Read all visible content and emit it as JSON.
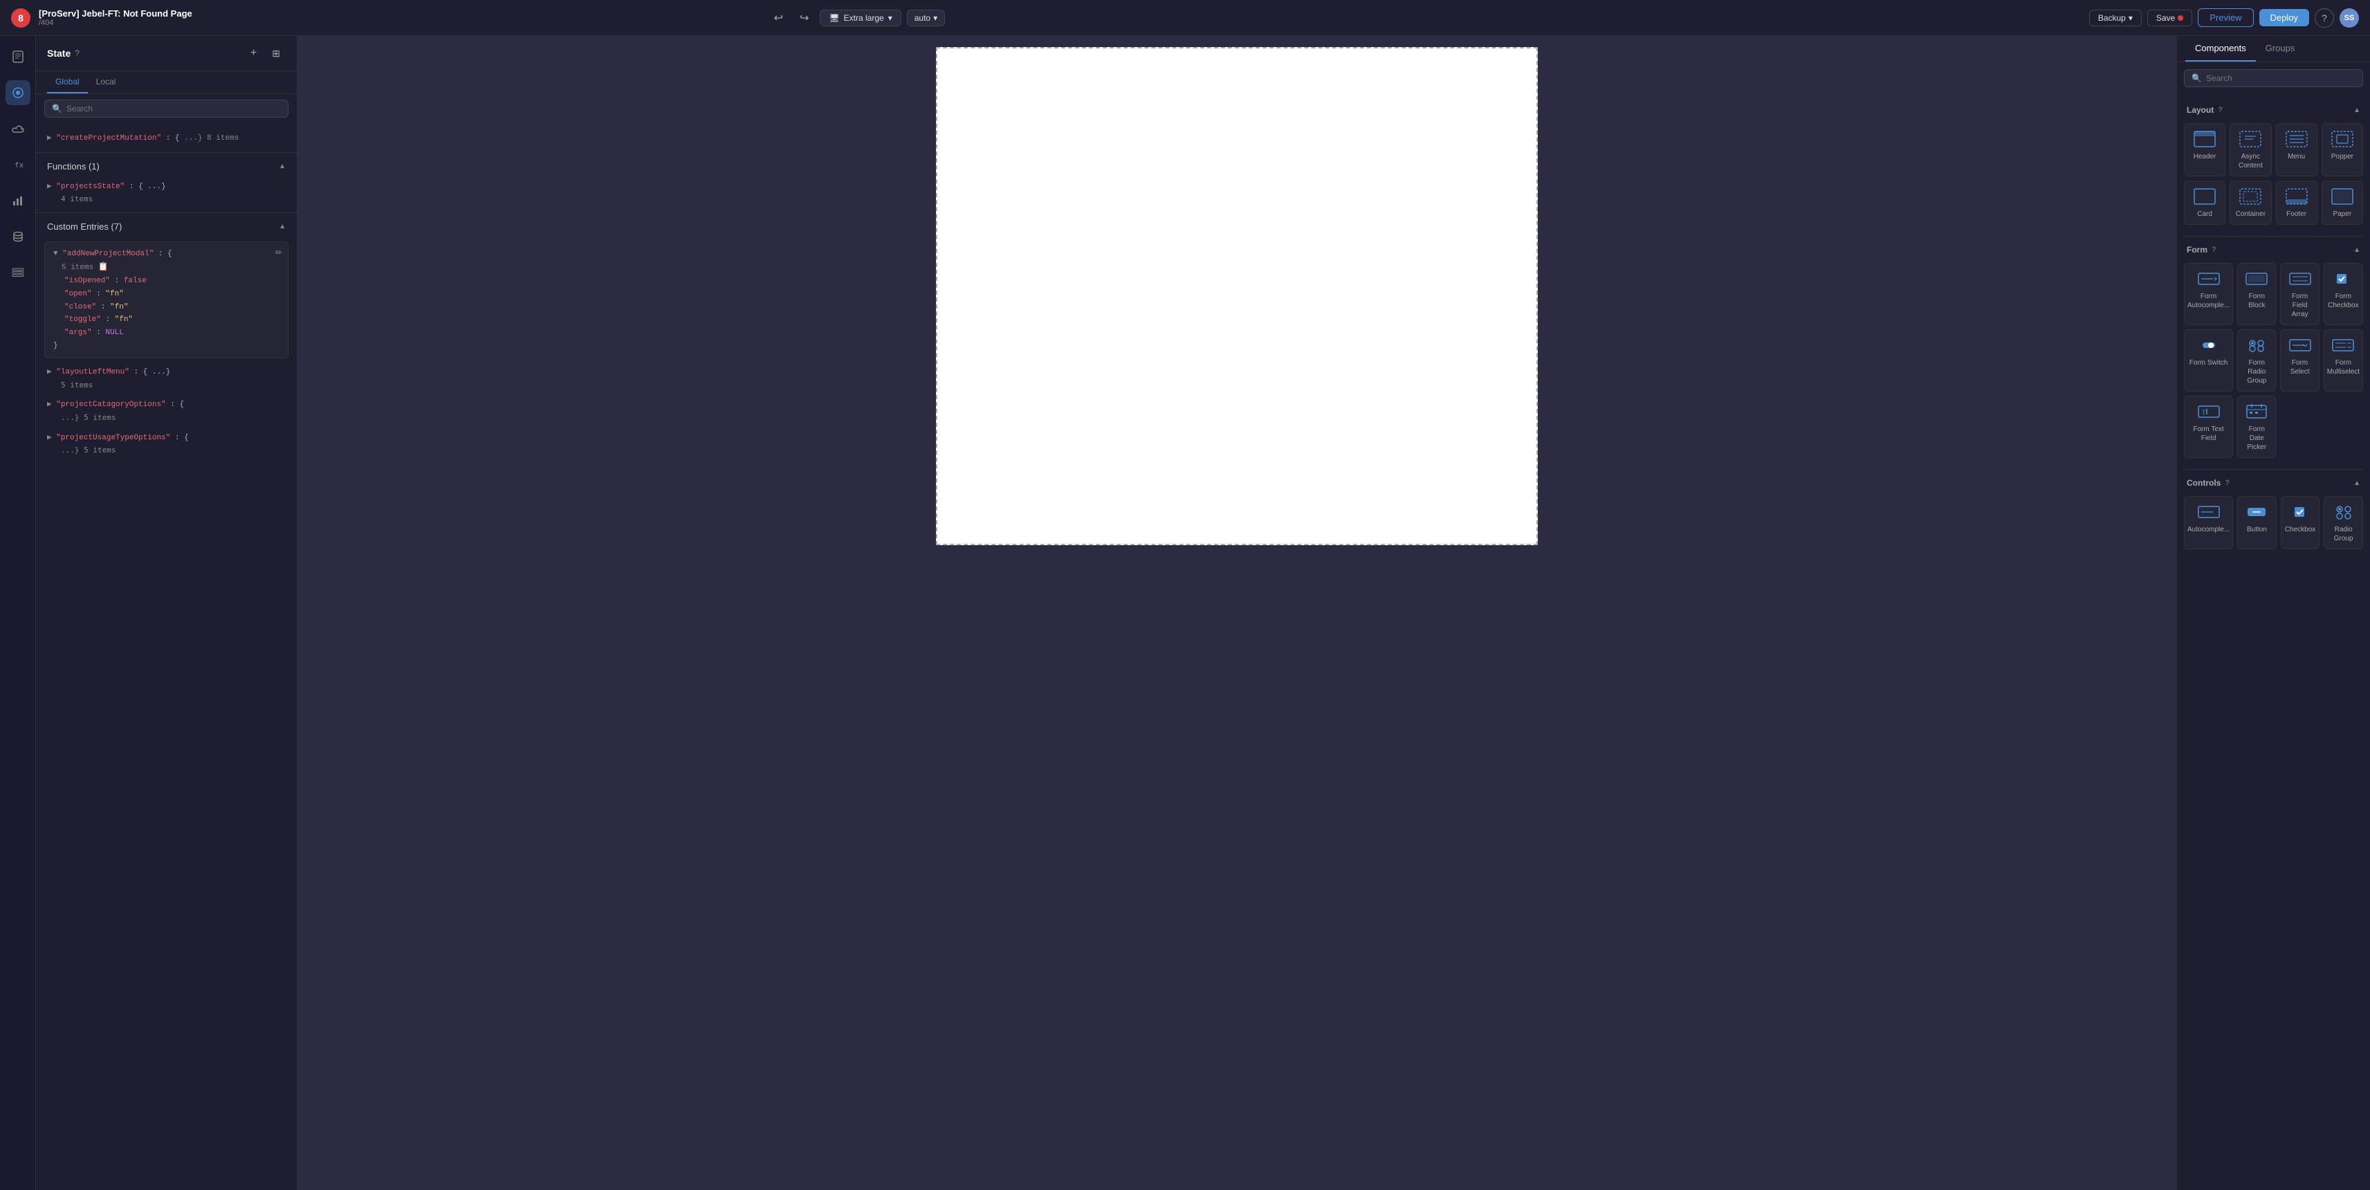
{
  "topbar": {
    "badge": "8",
    "title": "[ProServ] Jebel-FT: Not Found Page",
    "subtitle": "/404",
    "device_label": "Extra large",
    "auto_label": "auto",
    "backup_label": "Backup",
    "save_label": "Save",
    "preview_label": "Preview",
    "deploy_label": "Deploy",
    "avatar_label": "SS"
  },
  "left_panel": {
    "title": "State",
    "tabs": [
      "Global",
      "Local"
    ],
    "active_tab": "Global",
    "search_placeholder": "Search",
    "functions_title": "Functions (1)",
    "custom_entries_title": "Custom Entries (7)",
    "state_entries": [
      {
        "key": "\"createProjectMutation\"",
        "value": "{ ...} 8 items"
      }
    ],
    "functions_entries": [
      {
        "key": "\"projectsState\"",
        "value": "{ ...}",
        "sub": "4 items"
      }
    ],
    "custom_entries": [
      {
        "key": "\"addNewProjectModal\"",
        "value": "{",
        "sub_label": "5 items",
        "fields": [
          {
            "key": "\"isOpened\"",
            "value": "false",
            "type": "bool-false"
          },
          {
            "key": "\"open\"",
            "value": "\"fn\"",
            "type": "string"
          },
          {
            "key": "\"close\"",
            "value": "\"fn\"",
            "type": "string"
          },
          {
            "key": "\"toggle\"",
            "value": "\"fn\"",
            "type": "string"
          },
          {
            "key": "\"args\"",
            "value": "NULL",
            "type": "null"
          }
        ]
      },
      {
        "key": "\"layoutLeftMenu\"",
        "value": "{ ...}",
        "sub": "5 items"
      },
      {
        "key": "\"projectCatagoryOptions\"",
        "value": "{ ...} 5 items"
      },
      {
        "key": "\"projectUsageTypeOptions\"",
        "value": "{ ...} 5 items"
      }
    ]
  },
  "right_panel": {
    "tabs": [
      "Components",
      "Groups"
    ],
    "active_tab": "Components",
    "search_placeholder": "Search",
    "layout_title": "Layout",
    "layout_items": [
      {
        "label": "Header",
        "icon": "header"
      },
      {
        "label": "Async Content",
        "icon": "async"
      },
      {
        "label": "Menu",
        "icon": "menu"
      },
      {
        "label": "Popper",
        "icon": "popper"
      },
      {
        "label": "Card",
        "icon": "card"
      },
      {
        "label": "Container",
        "icon": "container"
      },
      {
        "label": "Footer",
        "icon": "footer"
      },
      {
        "label": "Paper",
        "icon": "paper"
      }
    ],
    "form_title": "Form",
    "form_items": [
      {
        "label": "Form Autocomple...",
        "icon": "form-auto"
      },
      {
        "label": "Form Block",
        "icon": "form-block"
      },
      {
        "label": "Form Field Array",
        "icon": "form-field-array"
      },
      {
        "label": "Form Checkbox",
        "icon": "form-checkbox"
      },
      {
        "label": "Form Switch",
        "icon": "form-switch"
      },
      {
        "label": "Form Radio Group",
        "icon": "form-radio"
      },
      {
        "label": "Form Select",
        "icon": "form-select"
      },
      {
        "label": "Form Multiselect",
        "icon": "form-multiselect"
      },
      {
        "label": "Form Text Field",
        "icon": "form-text"
      },
      {
        "label": "Form Date Picker",
        "icon": "form-date"
      }
    ],
    "controls_title": "Controls",
    "controls_items": [
      {
        "label": "Autocomple...",
        "icon": "autocomplete"
      },
      {
        "label": "Button",
        "icon": "button"
      },
      {
        "label": "Checkbox",
        "icon": "checkbox"
      },
      {
        "label": "Radio Group",
        "icon": "radio-group"
      }
    ]
  }
}
